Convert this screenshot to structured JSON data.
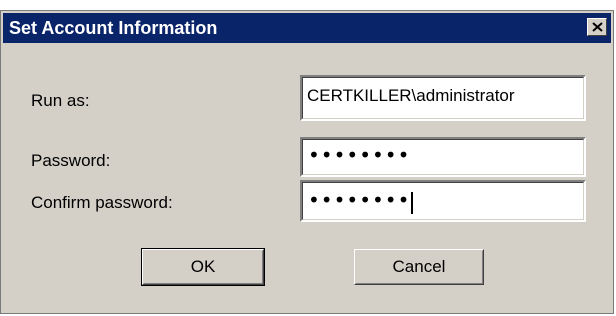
{
  "window": {
    "title": "Set Account Information"
  },
  "form": {
    "run_as_label": "Run as:",
    "run_as_value": "CERTKILLER\\administrator",
    "password_label": "Password:",
    "password_value": "••••••••",
    "confirm_label": "Confirm password:",
    "confirm_value": "••••••••"
  },
  "buttons": {
    "ok": "OK",
    "cancel": "Cancel"
  },
  "icons": {
    "close": "close-icon"
  },
  "colors": {
    "titlebar": "#0a246a",
    "dialog_bg": "#d4d0c8"
  }
}
